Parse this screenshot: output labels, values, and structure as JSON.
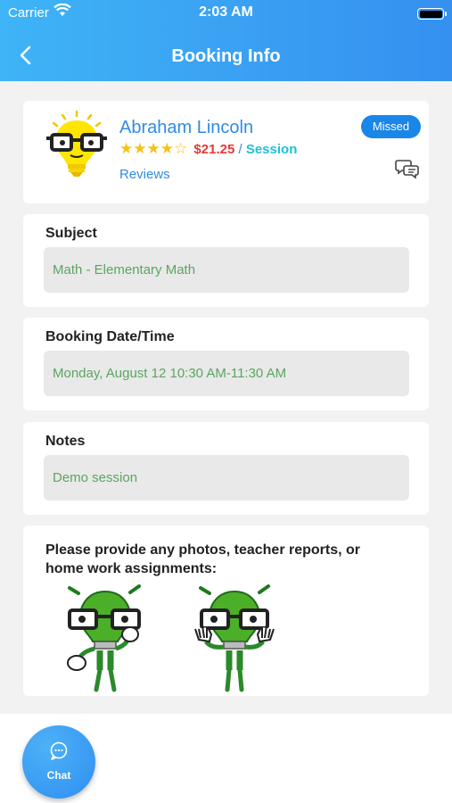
{
  "status_bar": {
    "carrier": "Carrier",
    "time": "2:03 AM"
  },
  "header": {
    "title": "Booking Info"
  },
  "tutor": {
    "name": "Abraham Lincoln",
    "rating": 4,
    "rating_max": 5,
    "price": "$21.25",
    "separator": " / ",
    "unit": "Session",
    "reviews_label": "Reviews",
    "status": "Missed"
  },
  "subject": {
    "label": "Subject",
    "value": "Math - Elementary Math"
  },
  "booking": {
    "label": "Booking Date/Time",
    "value": "Monday, August 12 10:30 AM-11:30 AM"
  },
  "notes": {
    "label": "Notes",
    "value": "Demo session"
  },
  "uploads": {
    "prompt": "Please provide any photos, teacher reports, or home work assignments:"
  },
  "fab": {
    "label": "Chat"
  },
  "colors": {
    "header_start": "#3fb4f6",
    "header_end": "#3590f0",
    "badge": "#1a86e8",
    "field_text": "#5aa65f",
    "price": "#e53935",
    "star": "#f5c11a"
  }
}
